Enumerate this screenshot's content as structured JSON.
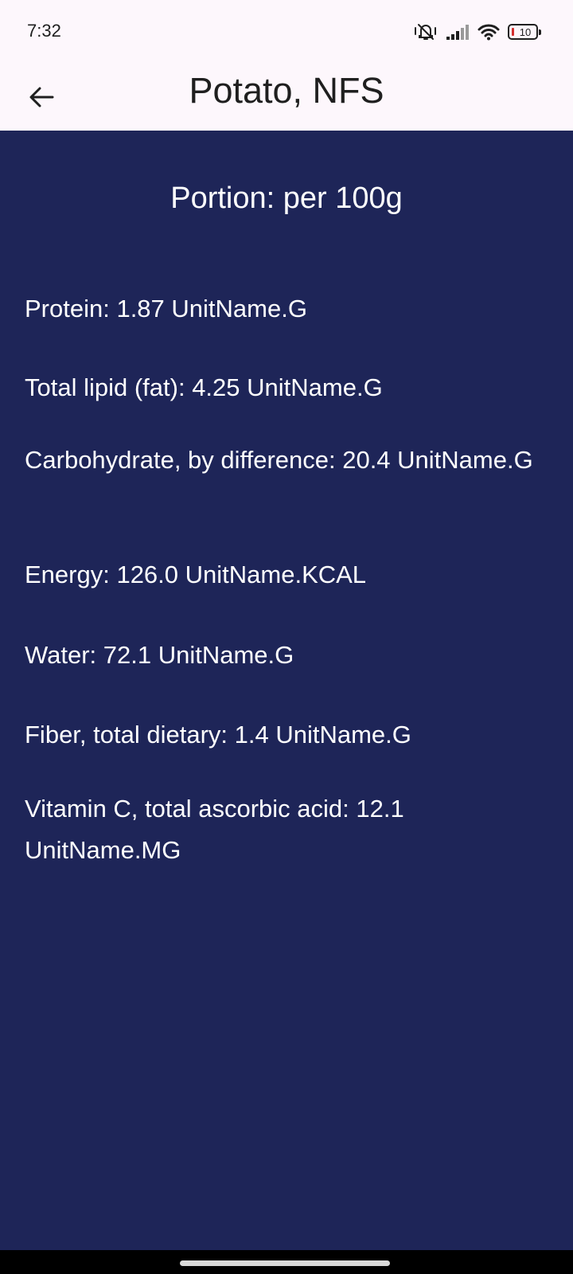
{
  "status_bar": {
    "time": "7:32",
    "battery_level": "10",
    "icons": [
      "mute-vibrate-icon",
      "signal-icon",
      "wifi-icon",
      "battery-icon"
    ]
  },
  "app_bar": {
    "title": "Potato, NFS",
    "back_icon": "arrow-back-icon"
  },
  "content": {
    "portion": "Portion: per 100g",
    "nutrients": [
      "Protein: 1.87 UnitName.G",
      "Total lipid (fat): 4.25 UnitName.G",
      "Carbohydrate, by difference: 20.4 UnitName.G",
      "Energy: 126.0 UnitName.KCAL",
      "Water: 72.1 UnitName.G",
      "Fiber, total dietary: 1.4 UnitName.G",
      "Vitamin C, total ascorbic acid: 12.1 UnitName.MG"
    ]
  },
  "colors": {
    "app_bar_background": "#fdf7fc",
    "content_background": "#1e2558",
    "content_text": "#ffffff",
    "battery_low": "#d32f2f"
  }
}
